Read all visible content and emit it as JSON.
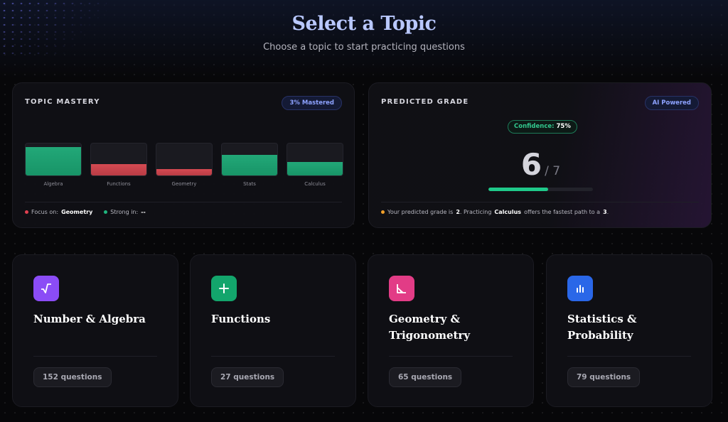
{
  "header": {
    "title": "Select a Topic",
    "subtitle": "Choose a topic to start practicing questions"
  },
  "mastery": {
    "label": "TOPIC MASTERY",
    "badge": "3% Mastered",
    "bars": [
      {
        "name": "Algebra",
        "fill": 0.88,
        "status": "green"
      },
      {
        "name": "Functions",
        "fill": 0.35,
        "status": "red"
      },
      {
        "name": "Geometry",
        "fill": 0.2,
        "status": "red"
      },
      {
        "name": "Stats",
        "fill": 0.65,
        "status": "green"
      },
      {
        "name": "Calculus",
        "fill": 0.42,
        "status": "green"
      }
    ],
    "focus_label": "Focus on:",
    "focus_value": "Geometry",
    "strong_label": "Strong in:",
    "strong_value": "--"
  },
  "predicted": {
    "label": "PREDICTED GRADE",
    "badge": "AI Powered",
    "confidence_label": "Confidence:",
    "confidence_value": "75%",
    "grade": "6",
    "grade_max": "/ 7",
    "progress": 0.57,
    "footer_pre": "Your predicted grade is",
    "footer_grade": "2",
    "footer_mid": ". Practicing",
    "footer_topic": "Calculus",
    "footer_post": "offers the fastest path to a",
    "footer_target": "3",
    "footer_end": "."
  },
  "cards": [
    {
      "title": "Number & Algebra",
      "count": "152 questions",
      "icon": "sqrt-icon",
      "color": "#8b4cf6"
    },
    {
      "title": "Functions",
      "count": "27 questions",
      "icon": "plus-icon",
      "color": "#13a56c"
    },
    {
      "title": "Geometry & Trigonometry",
      "count": "65 questions",
      "icon": "angle-icon",
      "color": "#e23c86"
    },
    {
      "title": "Statistics & Probability",
      "count": "79 questions",
      "icon": "bar-chart-icon",
      "color": "#2a67e8"
    }
  ]
}
